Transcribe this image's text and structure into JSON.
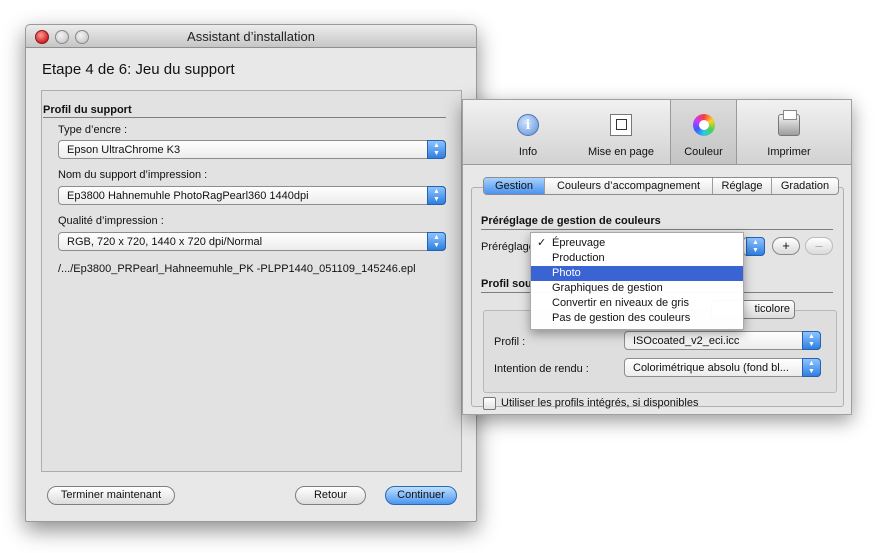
{
  "wizard": {
    "title": "Assistant d’installation",
    "step_heading": "Etape 4 de 6: Jeu du support",
    "section_title": "Profil du support",
    "ink_type_label": "Type d’encre :",
    "ink_type_value": "Epson UltraChrome K3",
    "media_name_label": "Nom du support d’impression :",
    "media_name_value": "Ep3800 Hahnemuhle PhotoRagPearl360 1440dpi",
    "quality_label": "Qualité d’impression :",
    "quality_value": "RGB, 720 x 720, 1440 x 720 dpi/Normal",
    "file_path": "/.../Ep3800_PRPearl_Hahneemuhle_PK -PLPP1440_051109_145246.epl",
    "buttons": {
      "finish_now": "Terminer maintenant",
      "back": "Retour",
      "continue": "Continuer"
    }
  },
  "print_dialog": {
    "toolbar": [
      {
        "label": "Info",
        "icon": "info-icon"
      },
      {
        "label": "Mise en page",
        "icon": "page-setup-icon"
      },
      {
        "label": "Couleur",
        "icon": "color-wheel-icon",
        "selected": true
      },
      {
        "label": "Imprimer",
        "icon": "printer-icon"
      }
    ],
    "tabs": [
      "Gestion",
      "Couleurs d’accompagnement",
      "Réglage",
      "Gradation"
    ],
    "selected_tab": "Gestion",
    "preset_section_title": "Préréglage de gestion de couleurs",
    "preset_label": "Préréglage",
    "add_symbol": "+",
    "remove_symbol": "–",
    "source_profile_title_partial": "Profil sou",
    "multicolor_partial": "ticolore",
    "profile_label": "Profil :",
    "profile_value": "ISOcoated_v2_eci.icc",
    "intent_label": "Intention de rendu :",
    "intent_value": "Colorimétrique absolu (fond bl...",
    "use_embedded_label": "Utiliser les profils intégrés, si disponibles"
  },
  "preset_menu": {
    "check_mark": "✓",
    "items": [
      "Épreuvage",
      "Production",
      "Photo",
      "Graphiques de gestion",
      "Convertir en niveaux de gris",
      "Pas de gestion des couleurs"
    ],
    "checked_index": 0,
    "highlighted_index": 2
  },
  "colors": {
    "accent_blue": "#3a63d4",
    "close_red": "#d62b2b"
  }
}
